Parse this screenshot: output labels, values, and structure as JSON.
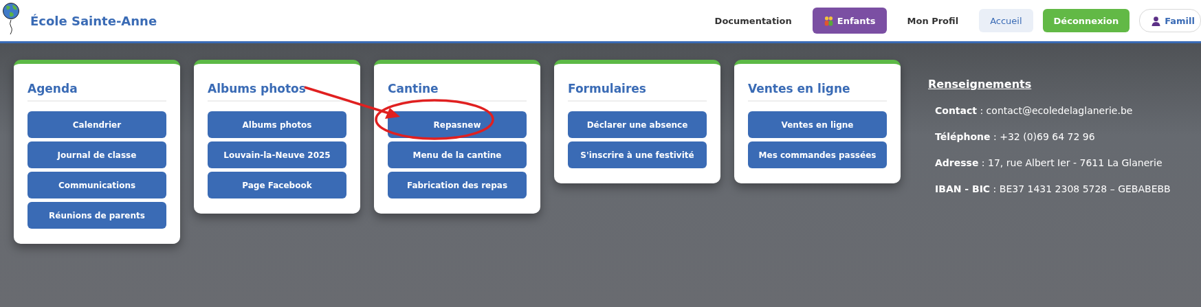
{
  "header": {
    "title": "École Sainte-Anne",
    "nav": [
      {
        "label": "Documentation",
        "kind": "link"
      },
      {
        "label": "Enfants",
        "kind": "purple"
      },
      {
        "label": "Mon Profil",
        "kind": "link"
      },
      {
        "label": "Accueil",
        "kind": "light"
      },
      {
        "label": "Déconnexion",
        "kind": "green"
      },
      {
        "label": "Famill",
        "kind": "outline"
      }
    ]
  },
  "cards": [
    {
      "title": "Agenda",
      "buttons": [
        "Calendrier",
        "Journal de classe",
        "Communications",
        "Réunions de parents"
      ]
    },
    {
      "title": "Albums photos",
      "buttons": [
        "Albums photos",
        "Louvain-la-Neuve 2025",
        "Page Facebook"
      ]
    },
    {
      "title": "Cantine",
      "buttons": [
        "Repasnew",
        "Menu de la cantine",
        "Fabrication des repas"
      ]
    },
    {
      "title": "Formulaires",
      "buttons": [
        "Déclarer une absence",
        "S'inscrire à une festivité"
      ]
    },
    {
      "title": "Ventes en ligne",
      "buttons": [
        "Ventes en ligne",
        "Mes commandes passées"
      ]
    }
  ],
  "info": {
    "title": "Renseignements",
    "rows": [
      "**Contact** : contact@ecoledelaglanerie.be",
      "**Téléphone** : +32 (0)69 64 72 96",
      "**Adresse** : 17, rue Albert Ier - 7611 La Glanerie",
      "**IBAN - BIC** : BE37 1431 2308 5728 – GEBABEBB"
    ]
  }
}
